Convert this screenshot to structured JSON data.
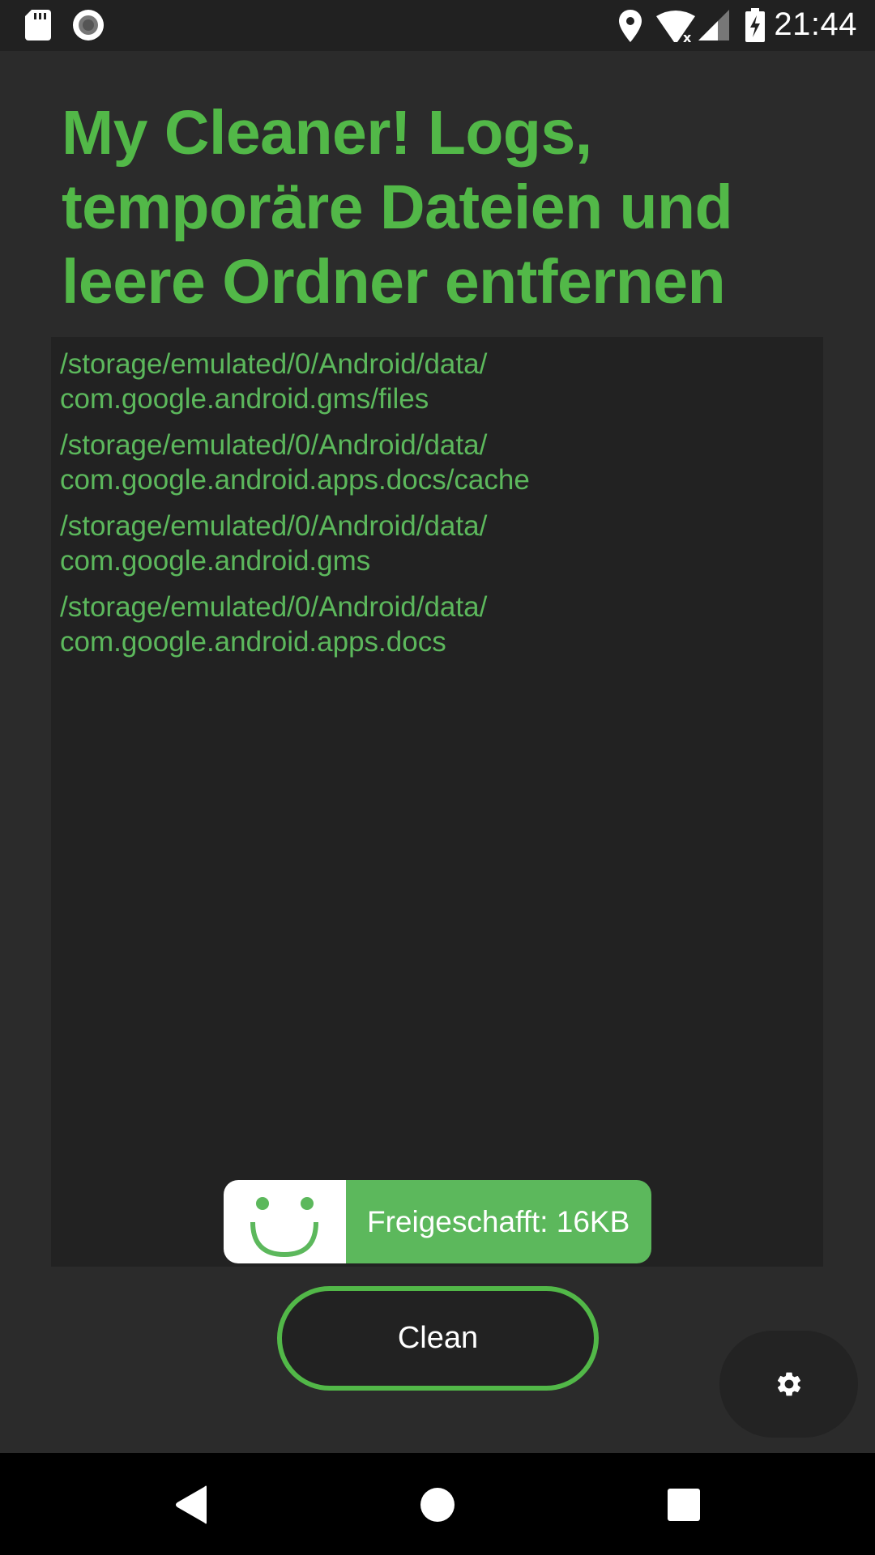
{
  "status_bar": {
    "time": "21:44",
    "icons": [
      "sd-card-icon",
      "record-icon",
      "location-icon",
      "wifi-off-icon",
      "signal-icon",
      "battery-charging-icon"
    ]
  },
  "app": {
    "title": "My Cleaner! Logs, temporäre Dateien und leere Ordner entfernen",
    "accent_color": "#52b848",
    "log_entries": [
      {
        "line1": "/storage/emulated/0/Android/data/",
        "line2": "com.google.android.gms/files"
      },
      {
        "line1": "/storage/emulated/0/Android/data/",
        "line2": "com.google.android.apps.docs/cache"
      },
      {
        "line1": "/storage/emulated/0/Android/data/",
        "line2": "com.google.android.gms"
      },
      {
        "line1": "/storage/emulated/0/Android/data/",
        "line2": "com.google.android.apps.docs"
      }
    ],
    "toast": {
      "icon": "smiley-icon",
      "text": "Freigeschafft: 16KB"
    },
    "clean_button_label": "Clean",
    "settings_icon": "gear-icon"
  },
  "nav_bar": {
    "buttons": [
      "back-icon",
      "home-icon",
      "recents-icon"
    ]
  }
}
